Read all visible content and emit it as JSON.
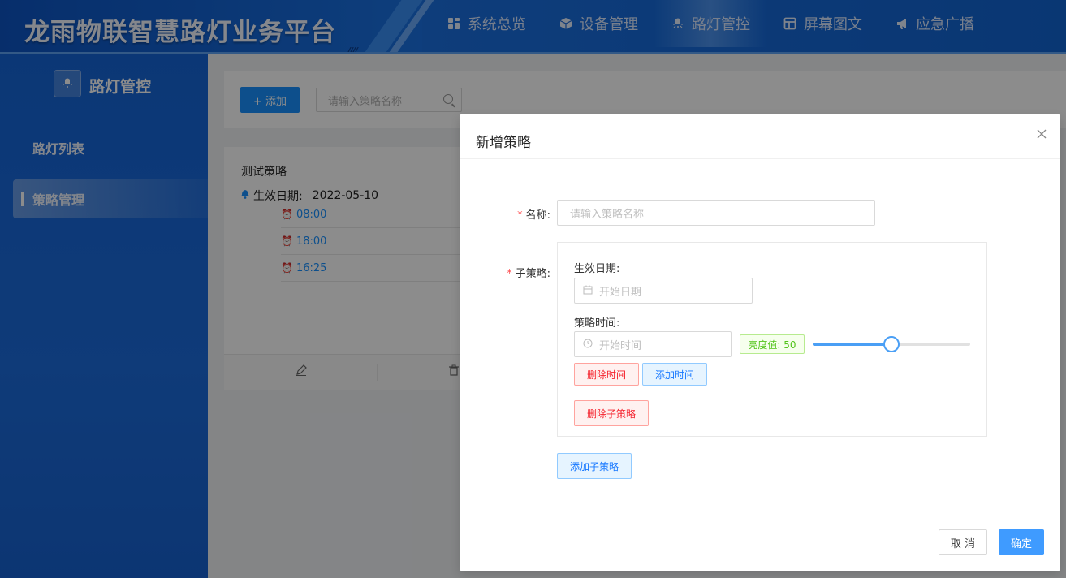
{
  "app": {
    "title": "龙雨物联智慧路灯业务平台"
  },
  "nav": {
    "items": [
      {
        "label": "系统总览",
        "icon": "grid-icon"
      },
      {
        "label": "设备管理",
        "icon": "cube-icon"
      },
      {
        "label": "路灯管控",
        "icon": "streetlight-icon",
        "active": true
      },
      {
        "label": "屏幕图文",
        "icon": "layout-icon"
      },
      {
        "label": "应急广播",
        "icon": "megaphone-icon"
      }
    ]
  },
  "sidebar": {
    "header": "路灯管控",
    "items": [
      {
        "label": "路灯列表"
      },
      {
        "label": "策略管理",
        "active": true
      }
    ]
  },
  "toolbar": {
    "add_label": "+ 添加",
    "search_placeholder": "请输入策略名称"
  },
  "card": {
    "title": "测试策略",
    "date_label": "生效日期:",
    "date_value": "2022-05-10",
    "times": [
      "08:00",
      "18:00",
      "16:25"
    ]
  },
  "modal": {
    "title": "新增策略",
    "name_label": "名称:",
    "name_placeholder": "请输入策略名称",
    "sub_label": "子策略:",
    "date_label": "生效日期:",
    "date_placeholder": "开始日期",
    "time_label": "策略时间:",
    "time_placeholder": "开始时间",
    "brightness_tag": "亮度值: 50",
    "brightness_value": 50,
    "delete_time": "删除时间",
    "add_time": "添加时间",
    "delete_sub": "删除子策略",
    "add_sub": "添加子策略",
    "cancel": "取 消",
    "ok": "确定"
  },
  "colors": {
    "primary": "#1890ff",
    "header_blue": "#1565d8",
    "danger": "#f5222d",
    "success": "#52c41a"
  }
}
